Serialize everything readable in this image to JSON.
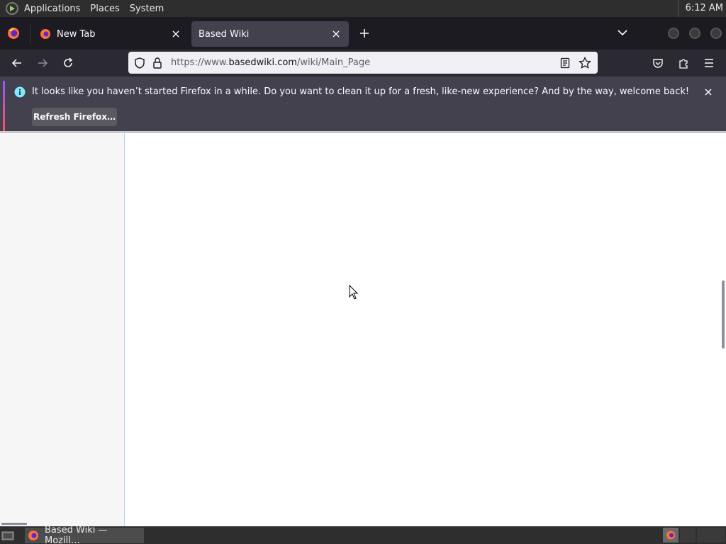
{
  "top_panel": {
    "menus": [
      "Applications",
      "Places",
      "System"
    ],
    "clock": "6:12 AM"
  },
  "tabs": [
    {
      "title": "New Tab",
      "active": false
    },
    {
      "title": "Based Wiki",
      "active": true
    }
  ],
  "navbar": {
    "url_prefix": "https://www.",
    "url_host": "basedwiki.com",
    "url_path": "/wiki/Main_Page"
  },
  "notification": {
    "message": "It looks like you haven’t started Firefox in a while. Do you want to clean it up for a fresh, like-new experience? And by the way, welcome back!",
    "button_label": "Refresh Firefox…"
  },
  "taskbar": {
    "task_label": "Based Wiki — Mozill…"
  },
  "colors": {
    "accent_purple": "#9059ff",
    "info_blue": "#0090ed",
    "firefox_orange": "#ff7139"
  }
}
